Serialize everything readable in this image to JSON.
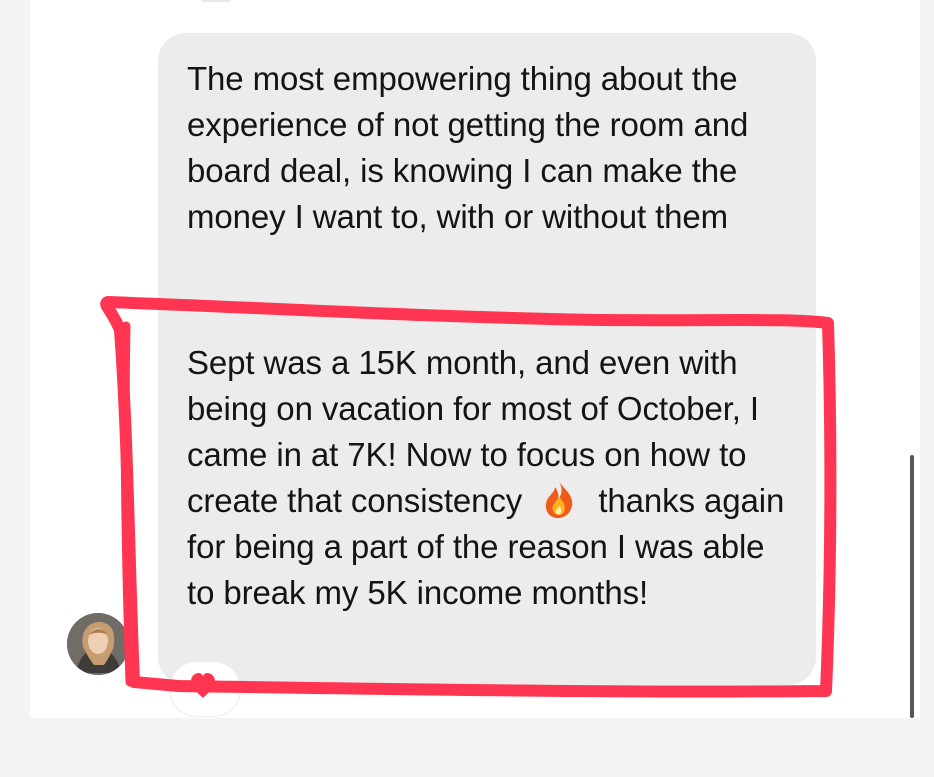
{
  "conversation": {
    "messages": [
      {
        "text": "The most empowering thing about the experience of not getting the room and board deal, is knowing I can make the money I want to, with or without them"
      },
      {
        "text_before_icon": "Sept was a 15K month, and even with being on vacation for most of October, I came in at 7K! Now to focus on how to create that consistency",
        "icon": "fire-icon",
        "text_after_icon": "thanks again for being a part of the reason I was able to break my 5K income months!"
      }
    ],
    "reaction": {
      "icon": "heart-icon",
      "color": "#ff334b"
    }
  },
  "colors": {
    "highlight": "#ff3551",
    "bubble": "#ececec",
    "background": "#f3f3f3"
  }
}
